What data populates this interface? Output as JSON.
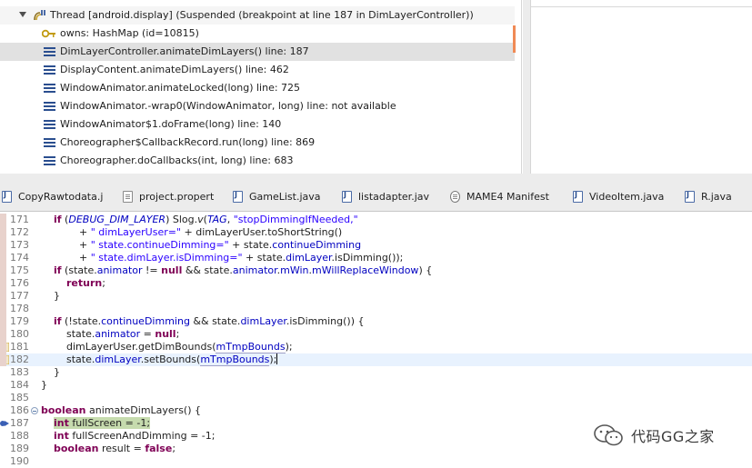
{
  "debug": {
    "thread_label": "Thread [android.display] (Suspended (breakpoint at line 187 in DimLayerController))",
    "owns_label": "owns: HashMap  (id=10815)",
    "frames": [
      "DimLayerController.animateDimLayers() line: 187",
      "DisplayContent.animateDimLayers() line: 462",
      "WindowAnimator.animateLocked(long) line: 725",
      "WindowAnimator.-wrap0(WindowAnimator, long) line: not available",
      "WindowAnimator$1.doFrame(long) line: 140",
      "Choreographer$CallbackRecord.run(long) line: 869",
      "Choreographer.doCallbacks(int, long) line: 683"
    ]
  },
  "tabs": [
    "CopyRawtodata.j",
    "project.propert",
    "GameList.java",
    "listadapter.jav",
    "MAME4 Manifest",
    "VideoItem.java",
    "R.java"
  ],
  "editor": {
    "lines": [
      {
        "num": "171",
        "tokens": [
          [
            "p",
            "    "
          ],
          [
            "kw",
            "if"
          ],
          [
            "p",
            " ("
          ],
          [
            "stat",
            "DEBUG_DIM_LAYER"
          ],
          [
            "p",
            ") Slog."
          ],
          [
            "i",
            "v"
          ],
          [
            "p",
            "("
          ],
          [
            "stat",
            "TAG"
          ],
          [
            "p",
            ", "
          ],
          [
            "str",
            "\"stopDimmingIfNeeded,\""
          ]
        ]
      },
      {
        "num": "172",
        "tokens": [
          [
            "p",
            "            + "
          ],
          [
            "str",
            "\" dimLayerUser=\""
          ],
          [
            "p",
            " + dimLayerUser.toShortString()"
          ]
        ]
      },
      {
        "num": "173",
        "tokens": [
          [
            "p",
            "            + "
          ],
          [
            "str",
            "\" state.continueDimming=\""
          ],
          [
            "p",
            " + state."
          ],
          [
            "fld",
            "continueDimming"
          ]
        ]
      },
      {
        "num": "174",
        "tokens": [
          [
            "p",
            "            + "
          ],
          [
            "str",
            "\" state.dimLayer.isDimming=\""
          ],
          [
            "p",
            " + state."
          ],
          [
            "fld",
            "dimLayer"
          ],
          [
            "p",
            ".isDimming());"
          ]
        ]
      },
      {
        "num": "175",
        "tokens": [
          [
            "p",
            "    "
          ],
          [
            "kw",
            "if"
          ],
          [
            "p",
            " (state."
          ],
          [
            "fld",
            "animator"
          ],
          [
            "p",
            " != "
          ],
          [
            "kw",
            "null"
          ],
          [
            "p",
            " && state."
          ],
          [
            "fld",
            "animator"
          ],
          [
            "p",
            "."
          ],
          [
            "fld",
            "mWin"
          ],
          [
            "p",
            "."
          ],
          [
            "fld",
            "mWillReplaceWindow"
          ],
          [
            "p",
            ") {"
          ]
        ]
      },
      {
        "num": "176",
        "tokens": [
          [
            "p",
            "        "
          ],
          [
            "kw",
            "return"
          ],
          [
            "p",
            ";"
          ]
        ]
      },
      {
        "num": "177",
        "tokens": [
          [
            "p",
            "    }"
          ]
        ]
      },
      {
        "num": "178",
        "tokens": []
      },
      {
        "num": "179",
        "tokens": [
          [
            "p",
            "    "
          ],
          [
            "kw",
            "if"
          ],
          [
            "p",
            " (!state."
          ],
          [
            "fld",
            "continueDimming"
          ],
          [
            "p",
            " && state."
          ],
          [
            "fld",
            "dimLayer"
          ],
          [
            "p",
            ".isDimming()) {"
          ]
        ]
      },
      {
        "num": "180",
        "tokens": [
          [
            "p",
            "        state."
          ],
          [
            "fld",
            "animator"
          ],
          [
            "p",
            " = "
          ],
          [
            "kw",
            "null"
          ],
          [
            "p",
            ";"
          ]
        ]
      },
      {
        "num": "181",
        "tokens": [
          [
            "p",
            "        dimLayerUser.getDimBounds("
          ],
          [
            "box",
            "mTmpBounds"
          ],
          [
            "p",
            ");"
          ]
        ]
      },
      {
        "num": "182",
        "tokens": [
          [
            "p",
            "        state."
          ],
          [
            "fld",
            "dimLayer"
          ],
          [
            "p",
            ".setBounds("
          ],
          [
            "box",
            "mTmpBounds"
          ],
          [
            "p",
            ");"
          ],
          [
            "caret",
            ""
          ]
        ]
      },
      {
        "num": "183",
        "tokens": [
          [
            "p",
            "    }"
          ]
        ]
      },
      {
        "num": "184",
        "tokens": [
          [
            "p",
            "}"
          ]
        ]
      },
      {
        "num": "185",
        "tokens": []
      },
      {
        "num": "186",
        "tokens": [
          [
            "kw",
            "boolean"
          ],
          [
            "p",
            " animateDimLayers() {"
          ]
        ]
      },
      {
        "num": "187",
        "tokens": [
          [
            "p",
            "    "
          ],
          [
            "hl_kw",
            "int"
          ],
          [
            "hl",
            " fullScreen = -1;"
          ]
        ]
      },
      {
        "num": "188",
        "tokens": [
          [
            "p",
            "    "
          ],
          [
            "kw",
            "int"
          ],
          [
            "p",
            " fullScreenAndDimming = -1;"
          ]
        ]
      },
      {
        "num": "189",
        "tokens": [
          [
            "p",
            "    "
          ],
          [
            "kw",
            "boolean"
          ],
          [
            "p",
            " result = "
          ],
          [
            "kw",
            "false"
          ],
          [
            "p",
            ";"
          ]
        ]
      },
      {
        "num": "190",
        "tokens": []
      }
    ]
  },
  "watermark": {
    "text": "代码GG之家"
  },
  "colors": {
    "keyword": "#7f0055",
    "field": "#0000c0",
    "string": "#2a00ff",
    "current_line": "#e8f2fe",
    "exec_highlight": "#c6dbae",
    "scroll_thumb": "#f08a55"
  }
}
